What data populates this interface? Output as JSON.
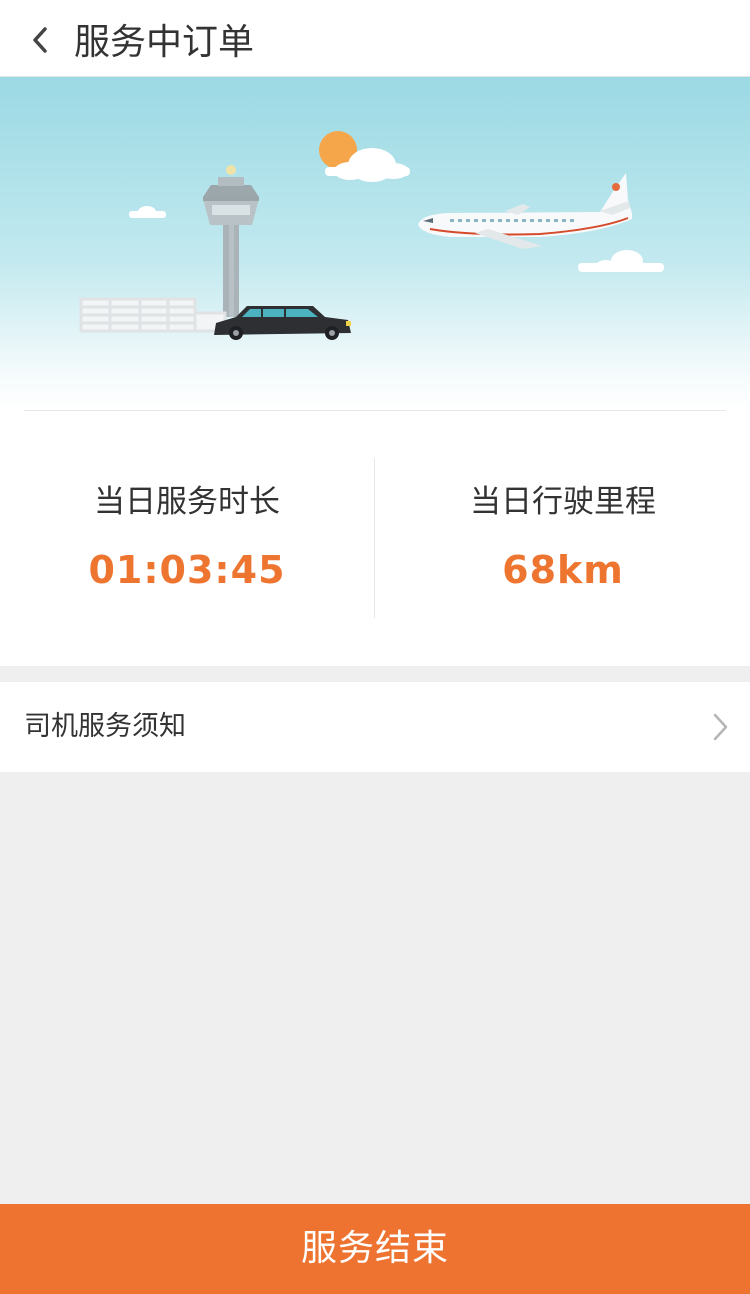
{
  "header": {
    "back_icon": "chevron-left-icon",
    "title": "服务中订单"
  },
  "banner": {
    "illustration": "airport-scene-illustration",
    "colors": {
      "sky_top": "#9bd9e4",
      "sun": "#f5a64a"
    }
  },
  "stats": {
    "duration": {
      "label": "当日服务时长",
      "value": "01:03:45"
    },
    "mileage": {
      "label": "当日行驶里程",
      "value": "68km"
    }
  },
  "notice": {
    "label": "司机服务须知",
    "arrow_icon": "chevron-right-icon"
  },
  "footer": {
    "end_service_label": "服务结束",
    "color": "#ee7330"
  },
  "accent_color": "#ee7530"
}
